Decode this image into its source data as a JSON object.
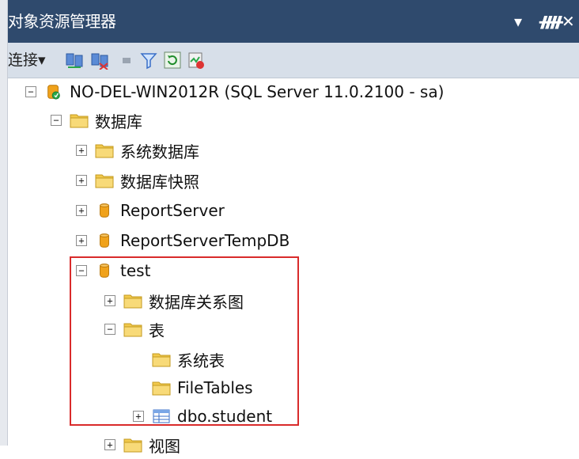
{
  "panel": {
    "title": "对象资源管理器",
    "controls": [
      "▾",
      "ᚃ",
      "✕"
    ]
  },
  "toolbar": {
    "connect_label": "连接▾"
  },
  "tree": {
    "server": "NO-DEL-WIN2012R (SQL Server 11.0.2100 - sa)",
    "databases": "数据库",
    "system_databases": "系统数据库",
    "db_snapshots": "数据库快照",
    "report_server": "ReportServer",
    "report_server_temp": "ReportServerTempDB",
    "test": "test",
    "db_diagrams": "数据库关系图",
    "tables": "表",
    "system_tables": "系统表",
    "file_tables": "FileTables",
    "dbo_student": "dbo.student",
    "views": "视图"
  },
  "colors": {
    "title_bg": "#2f4a6d",
    "toolbar_bg": "#d7dfe9",
    "highlight": "#d92b2b",
    "folder": "#f2c94c",
    "database": "#f0a21b"
  }
}
